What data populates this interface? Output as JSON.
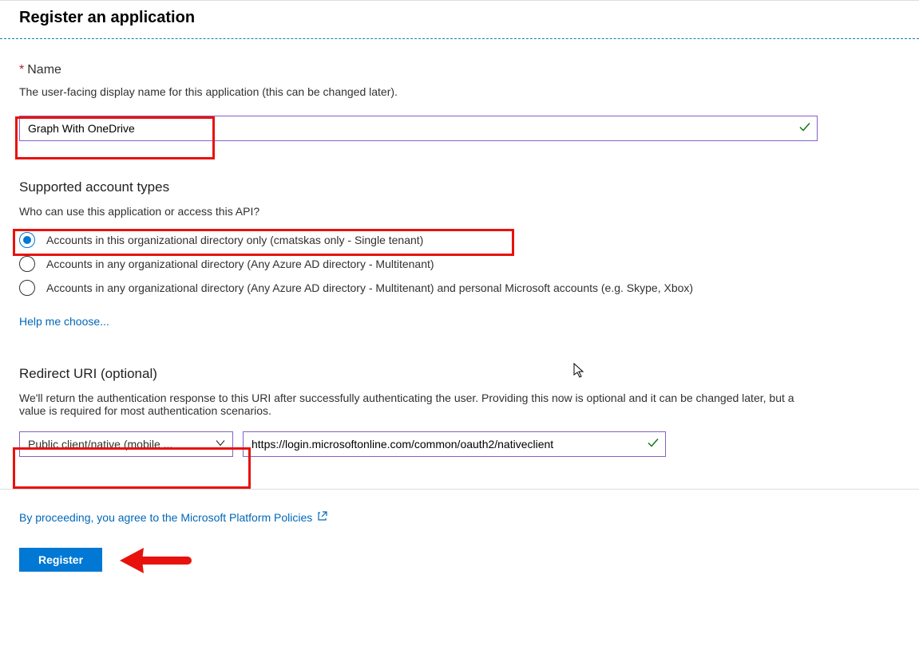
{
  "page_title": "Register an application",
  "name_section": {
    "label": "Name",
    "required_marker": "*",
    "description": "The user-facing display name for this application (this can be changed later).",
    "value": "Graph With OneDrive"
  },
  "account_types_section": {
    "heading": "Supported account types",
    "description": "Who can use this application or access this API?",
    "options": [
      "Accounts in this organizational directory only (cmatskas only - Single tenant)",
      "Accounts in any organizational directory (Any Azure AD directory - Multitenant)",
      "Accounts in any organizational directory (Any Azure AD directory - Multitenant) and personal Microsoft accounts (e.g. Skype, Xbox)"
    ],
    "selected_index": 0,
    "help_link": "Help me choose..."
  },
  "redirect_section": {
    "heading": "Redirect URI (optional)",
    "description": "We'll return the authentication response to this URI after successfully authenticating the user. Providing this now is optional and it can be changed later, but a value is required for most authentication scenarios.",
    "platform_display": "Public client/native (mobile ...",
    "uri_value": "https://login.microsoftonline.com/common/oauth2/nativeclient"
  },
  "footer": {
    "agree_text": "By proceeding, you agree to the Microsoft Platform Policies",
    "register_button": "Register"
  }
}
